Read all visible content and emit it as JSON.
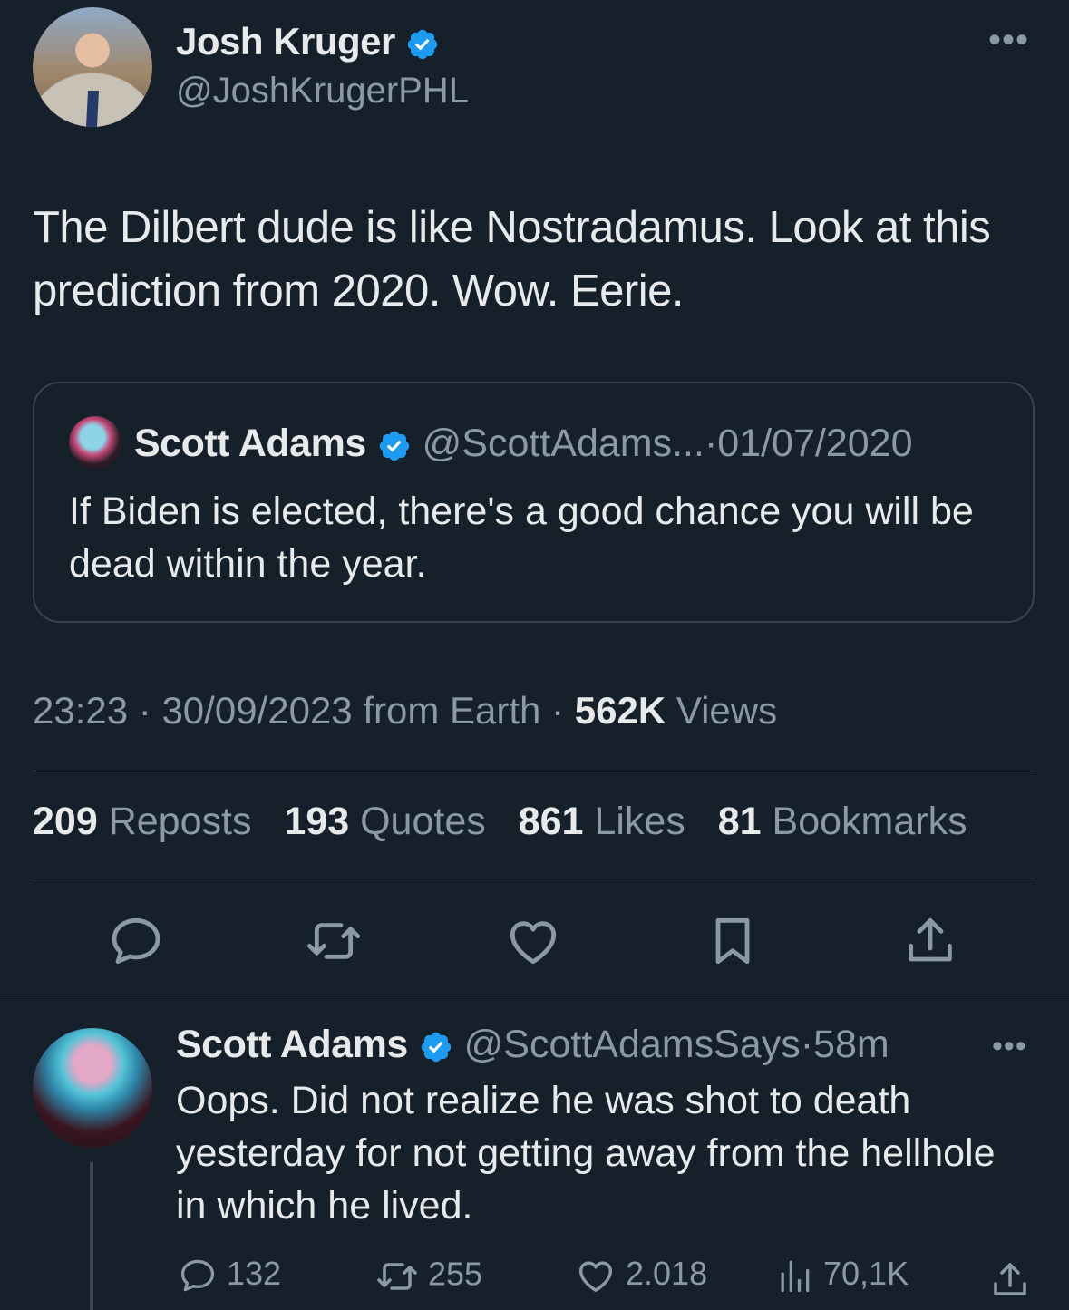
{
  "tweet": {
    "author_name": "Josh Kruger",
    "author_handle": "@JoshKrugerPHL",
    "text": "The Dilbert dude is like Nostradamus. Look at this prediction from 2020. Wow. Eerie.",
    "quote": {
      "name": "Scott Adams",
      "handle": "@ScottAdams...",
      "separator": "·",
      "date": "01/07/2020",
      "text": "If Biden is elected, there's a good chance you will be dead within the year."
    },
    "meta": {
      "time": "23:23",
      "date": "30/09/2023",
      "source": "from Earth",
      "separator": "·",
      "views_count": "562K",
      "views_label": "Views"
    },
    "stats": {
      "reposts_count": "209",
      "reposts_label": "Reposts",
      "quotes_count": "193",
      "quotes_label": "Quotes",
      "likes_count": "861",
      "likes_label": "Likes",
      "bookmarks_count": "81",
      "bookmarks_label": "Bookmarks"
    },
    "more_label": "•••"
  },
  "reply": {
    "name": "Scott Adams",
    "handle": "@ScottAdamsSays",
    "separator": "·",
    "time": "58m",
    "text": "Oops. Did not realize he was shot to death yesterday for not getting away from the hellhole in which he lived.",
    "replies": "132",
    "reposts": "255",
    "likes": "2.018",
    "views": "70,1K",
    "more_label": "•••"
  },
  "icons": {
    "verified": "verified-badge-icon",
    "reply": "reply-icon",
    "repost": "repost-icon",
    "like": "like-icon",
    "bookmark": "bookmark-icon",
    "share": "share-icon",
    "views": "views-icon"
  },
  "colors": {
    "background": "#15202b",
    "text": "#e7e9ea",
    "muted": "#8b98a5",
    "border": "#38444d",
    "verified": "#1d9bf0"
  }
}
